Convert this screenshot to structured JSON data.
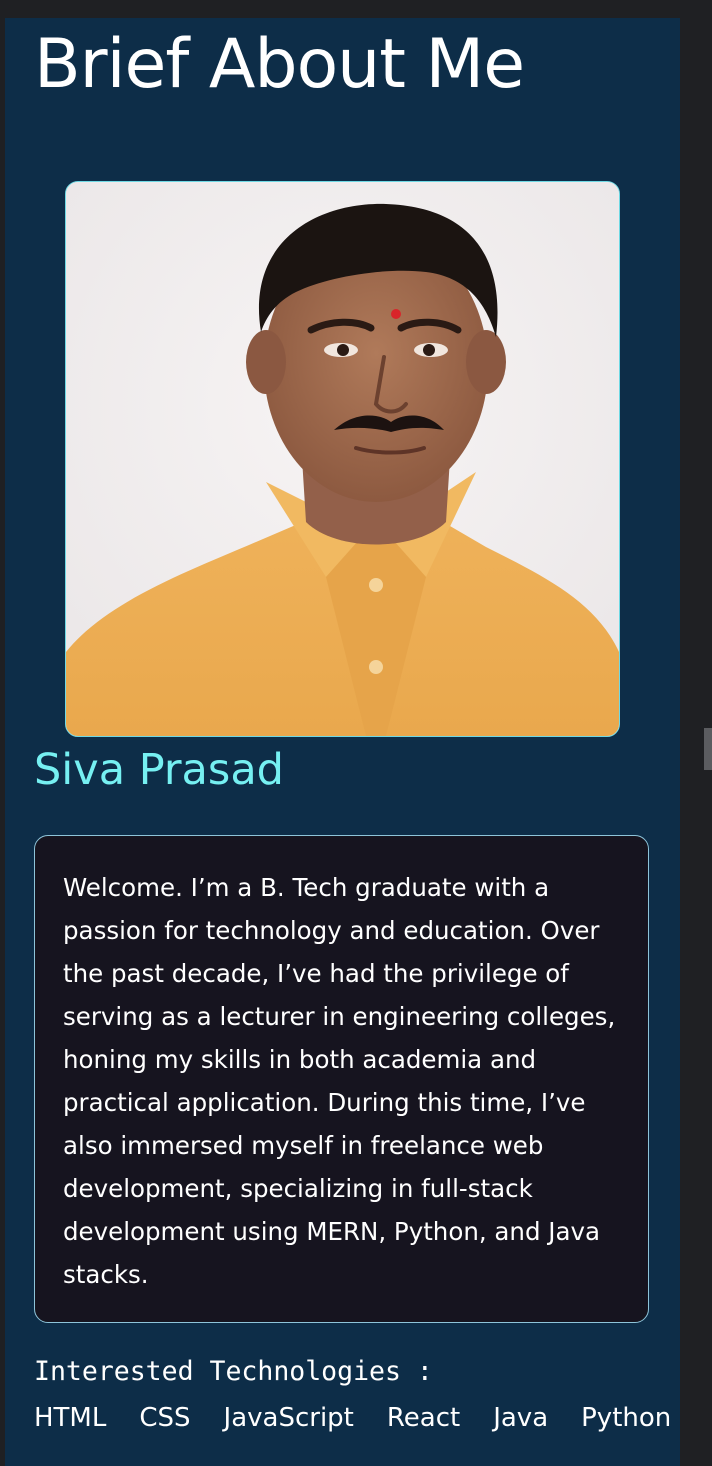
{
  "section": {
    "title": "Brief About Me"
  },
  "profile": {
    "name": "Siva Prasad",
    "photo_alt": "Siva Prasad"
  },
  "bio": {
    "text": "Welcome. I’m a B. Tech graduate with a passion for technology and education. Over the past decade, I’ve had the privilege of serving as a lecturer in engineering colleges, honing my skills in both academia and practical application. During this time, I’ve also immersed myself in freelance web development, specializing in full-stack development using MERN, Python, and Java stacks."
  },
  "technologies": {
    "heading": "Interested Technologies :",
    "items": [
      "HTML",
      "CSS",
      "JavaScript",
      "React",
      "Java",
      "Python"
    ]
  },
  "colors": {
    "background": "#1f2023",
    "panel": "#0d2d48",
    "card": "#16141f",
    "accent": "#76f0f2",
    "text": "#ffffff"
  }
}
